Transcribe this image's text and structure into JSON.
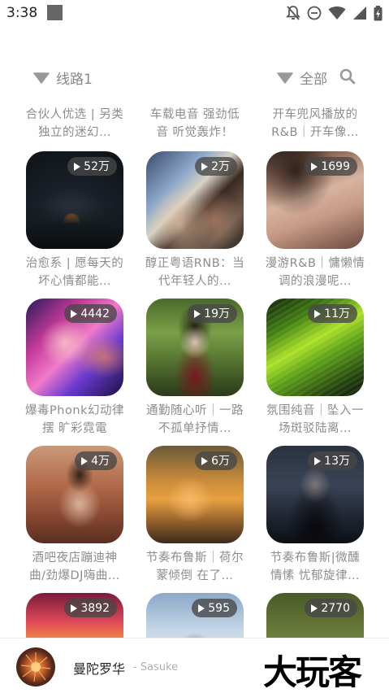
{
  "status": {
    "time": "3:38",
    "icons": [
      "notification-square-icon",
      "bell-off-icon",
      "do-not-disturb-icon",
      "wifi-icon",
      "signal-icon",
      "battery-charging-icon"
    ]
  },
  "filters": {
    "line_label": "线路1",
    "all_label": "全部"
  },
  "top_titles": [
    "合伙人优选 | 另类独立的迷幻…",
    "车载电音 强劲低音 听觉轰炸！",
    "开车兜风播放的R&B｜开车像…"
  ],
  "cards": [
    {
      "plays": "52万",
      "title": "治愈系 | 愿每天的坏心情都能…"
    },
    {
      "plays": "2万",
      "title": "醇正粤语RNB：当代年轻人的…"
    },
    {
      "plays": "1699",
      "title": "漫游R&B｜慵懒情调的浪漫呢…"
    },
    {
      "plays": "4442",
      "title": "爆毒Phonk幻动律摆 旷彩霓電"
    },
    {
      "plays": "19万",
      "title": "通勤随心听｜一路不孤单抒情…"
    },
    {
      "plays": "11万",
      "title": "氛围纯音｜坠入一场斑驳陆离…"
    },
    {
      "plays": "4万",
      "title": "酒吧夜店蹦迪神曲/劲爆DJ嗨曲…"
    },
    {
      "plays": "6万",
      "title": "节奏布鲁斯｜荷尔蒙倾倒 在了…"
    },
    {
      "plays": "13万",
      "title": "节奏布鲁斯|微醺情愫 忧郁旋律…"
    },
    {
      "plays": "3892",
      "title": ""
    },
    {
      "plays": "595",
      "title": ""
    },
    {
      "plays": "2770",
      "title": ""
    }
  ],
  "player": {
    "title": "曼陀罗华",
    "artist": "- Sasuke",
    "brand": "大玩客"
  }
}
